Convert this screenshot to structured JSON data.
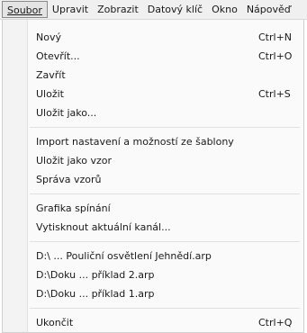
{
  "menubar": {
    "items": [
      {
        "label": "Soubor"
      },
      {
        "label": "Upravit"
      },
      {
        "label": "Zobrazit"
      },
      {
        "label": "Datový klíč"
      },
      {
        "label": "Okno"
      },
      {
        "label": "Nápověď"
      }
    ]
  },
  "menu": {
    "items": [
      {
        "label": "Nový",
        "shortcut": "Ctrl+N"
      },
      {
        "label": "Otevřít...",
        "shortcut": "Ctrl+O"
      },
      {
        "label": "Zavřít",
        "shortcut": ""
      },
      {
        "label": "Uložit",
        "shortcut": "Ctrl+S"
      },
      {
        "label": "Uložit jako...",
        "shortcut": ""
      },
      {
        "label": "Import nastavení a možností ze šablony",
        "shortcut": ""
      },
      {
        "label": "Uložit jako vzor",
        "shortcut": ""
      },
      {
        "label": "Správa vzorů",
        "shortcut": ""
      },
      {
        "label": "Grafika spínání",
        "shortcut": ""
      },
      {
        "label": "Vytisknout aktuální kanál...",
        "shortcut": ""
      },
      {
        "label": "D:\\ ... Pouliční osvětlení Jehnědí.arp",
        "shortcut": ""
      },
      {
        "label": "D:\\Doku ... příklad 2.arp",
        "shortcut": ""
      },
      {
        "label": "D:\\Doku ... příklad 1.arp",
        "shortcut": ""
      },
      {
        "label": "Ukončit",
        "shortcut": "Ctrl+Q"
      }
    ]
  }
}
